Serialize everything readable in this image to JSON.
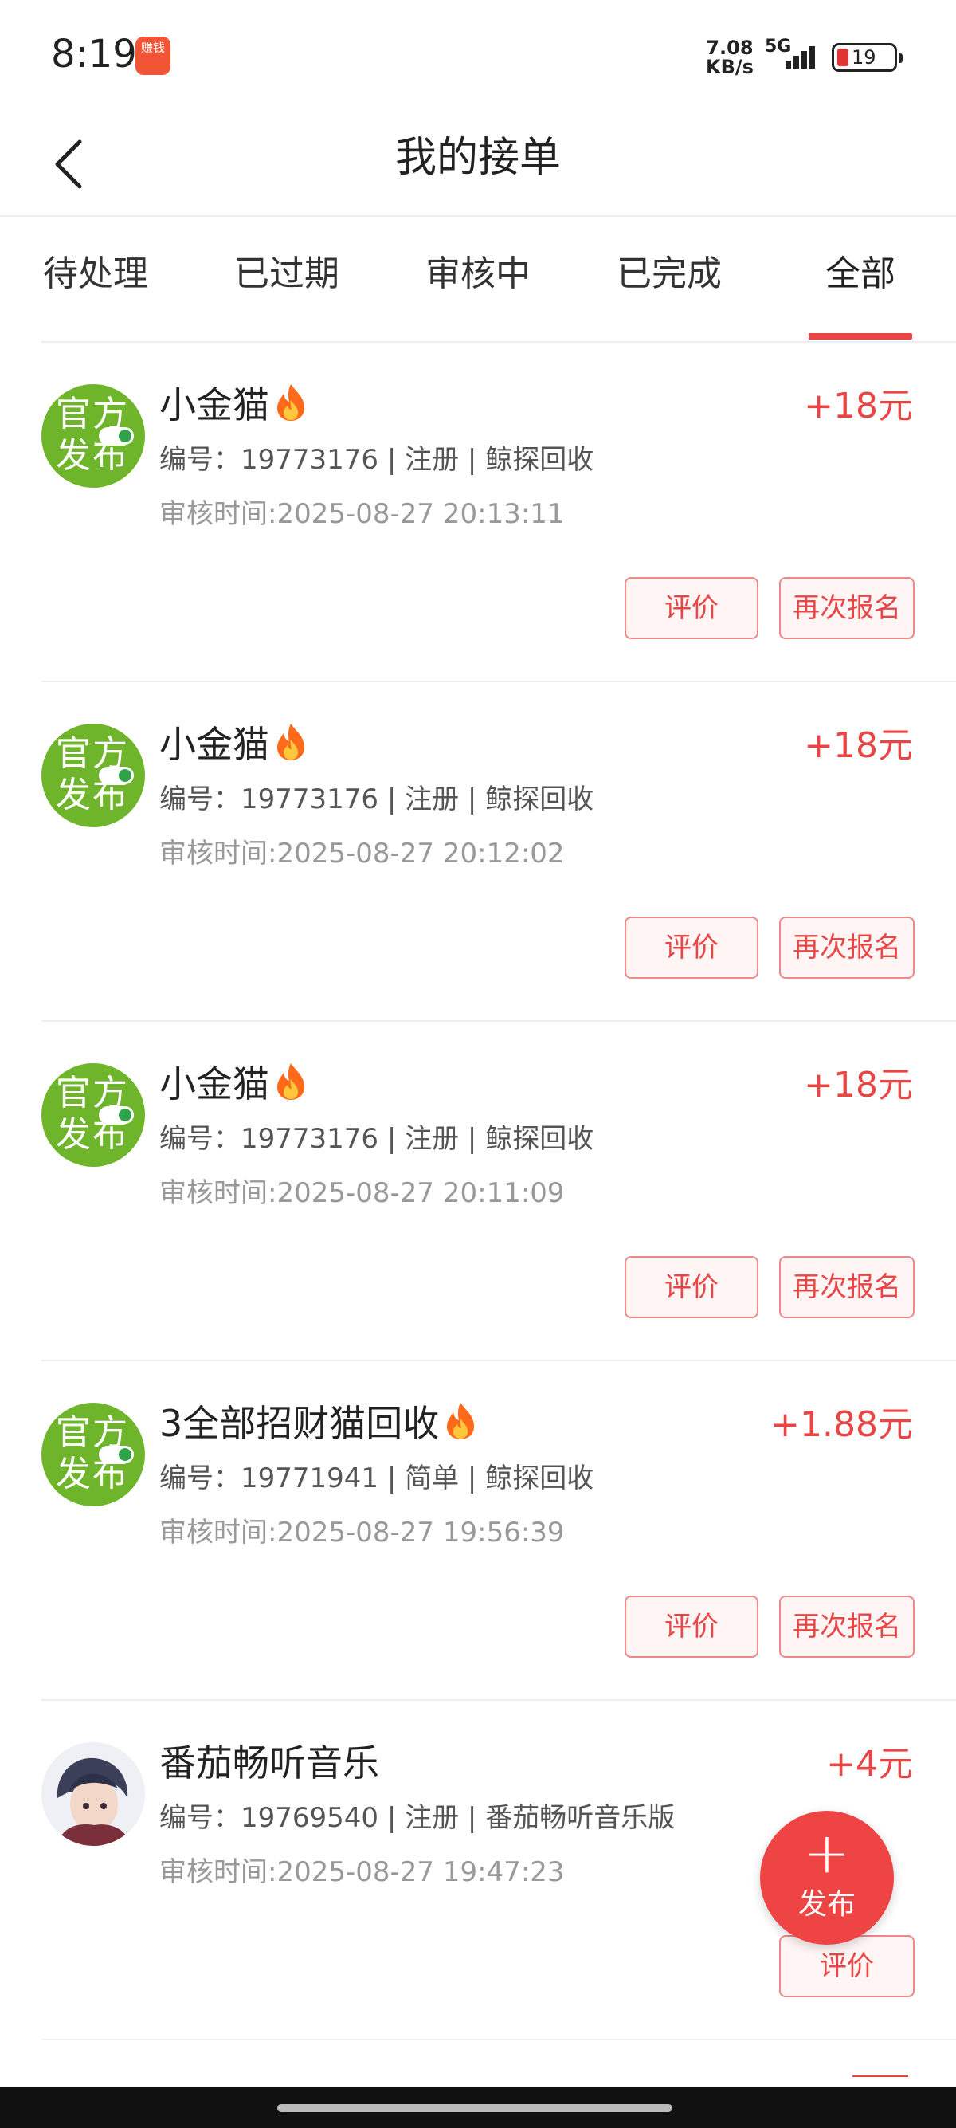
{
  "status_bar": {
    "time": "8:19",
    "app_icon_text_top": "赚钱",
    "app_icon_text_bottom": "",
    "speed_value": "7.08",
    "speed_unit": "KB/s",
    "network": "5G",
    "battery": "19",
    "battery_color": "#e23434"
  },
  "header": {
    "title": "我的接单",
    "back_icon": "chevron-left-icon"
  },
  "tabs": [
    {
      "label": "待处理",
      "active": false
    },
    {
      "label": "已过期",
      "active": false
    },
    {
      "label": "审核中",
      "active": false
    },
    {
      "label": "已完成",
      "active": false
    },
    {
      "label": "全部",
      "active": true
    }
  ],
  "accent_color": "#e94545",
  "orders": [
    {
      "avatar": {
        "type": "official",
        "line1": "官方",
        "line2": "发布"
      },
      "title": "小金猫",
      "hot": true,
      "price": "+18元",
      "meta": "编号：19773176 | 注册 | 鲸探回收",
      "time": "审核时间:2025-08-27 20:13:11",
      "btn_rate": "评价",
      "btn_again": "再次报名"
    },
    {
      "avatar": {
        "type": "official",
        "line1": "官方",
        "line2": "发布"
      },
      "title": "小金猫",
      "hot": true,
      "price": "+18元",
      "meta": "编号：19773176 | 注册 | 鲸探回收",
      "time": "审核时间:2025-08-27 20:12:02",
      "btn_rate": "评价",
      "btn_again": "再次报名"
    },
    {
      "avatar": {
        "type": "official",
        "line1": "官方",
        "line2": "发布"
      },
      "title": "小金猫",
      "hot": true,
      "price": "+18元",
      "meta": "编号：19773176 | 注册 | 鲸探回收",
      "time": "审核时间:2025-08-27 20:11:09",
      "btn_rate": "评价",
      "btn_again": "再次报名"
    },
    {
      "avatar": {
        "type": "official",
        "line1": "官方",
        "line2": "发布"
      },
      "title": "3全部招财猫回收",
      "hot": true,
      "price": "+1.88元",
      "meta": "编号：19771941 | 简单 | 鲸探回收",
      "time": "审核时间:2025-08-27 19:56:39",
      "btn_rate": "评价",
      "btn_again": "再次报名"
    },
    {
      "avatar": {
        "type": "person"
      },
      "title": "番茄畅听音乐",
      "hot": false,
      "price": "+4元",
      "meta": "编号：19769540 | 注册 | 番茄畅听音乐版",
      "time": "审核时间:2025-08-27 19:47:23",
      "btn_rate": "评价"
    }
  ],
  "fab": {
    "icon": "plus-icon",
    "label": "发布"
  }
}
